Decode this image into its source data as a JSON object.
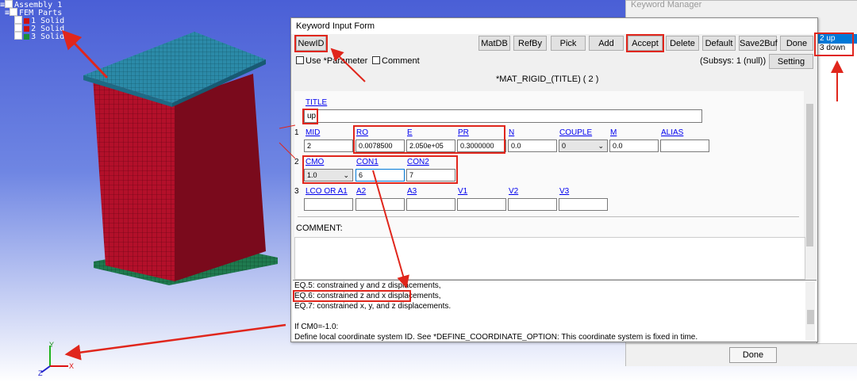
{
  "tree": {
    "assembly": "Assembly 1",
    "parts_group": "FEM Parts",
    "parts": [
      {
        "label": "1 Solid",
        "color": "#cc1111"
      },
      {
        "label": "2 Solid",
        "color": "#cc1111"
      },
      {
        "label": "3 Solid",
        "color": "#1a8f3a"
      }
    ]
  },
  "axis": {
    "x": "X",
    "y": "Y",
    "z": "Z"
  },
  "keyword_manager": {
    "title": "Keyword Manager",
    "items": [
      {
        "label": "2  up",
        "selected": true
      },
      {
        "label": "3  down",
        "selected": false
      }
    ],
    "done_label": "Done"
  },
  "form": {
    "title": "Keyword Input Form",
    "buttons": {
      "newid": "NewID",
      "matdb": "MatDB",
      "refby": "RefBy",
      "pick": "Pick",
      "add": "Add",
      "accept": "Accept",
      "delete": "Delete",
      "default": "Default",
      "save2buf": "Save2Buf",
      "done": "Done"
    },
    "use_parameter": "Use *Parameter",
    "comment_check": "Comment",
    "subsys": "(Subsys: 1 (null))",
    "setting": "Setting",
    "keyword": "*MAT_RIGID_(TITLE)  ( 2 )",
    "title_label": "TITLE",
    "title_value": "up",
    "row1_num": "1",
    "row1": [
      {
        "label": "MID",
        "value": "2"
      },
      {
        "label": "RO",
        "value": "0.0078500"
      },
      {
        "label": "E",
        "value": "2.050e+05"
      },
      {
        "label": "PR",
        "value": "0.3000000"
      },
      {
        "label": "N",
        "value": "0.0"
      },
      {
        "label": "COUPLE",
        "value": "0"
      },
      {
        "label": "M",
        "value": "0.0"
      },
      {
        "label": "ALIAS",
        "value": ""
      }
    ],
    "row2_num": "2",
    "row2": [
      {
        "label": "CMO",
        "value": "1.0"
      },
      {
        "label": "CON1",
        "value": "6"
      },
      {
        "label": "CON2",
        "value": "7"
      }
    ],
    "row3_num": "3",
    "row3": [
      {
        "label": "LCO OR A1",
        "value": ""
      },
      {
        "label": "A2",
        "value": ""
      },
      {
        "label": "A3",
        "value": ""
      },
      {
        "label": "V1",
        "value": ""
      },
      {
        "label": "V2",
        "value": ""
      },
      {
        "label": "V3",
        "value": ""
      }
    ],
    "comment_label": "COMMENT:",
    "help_lines": [
      "EQ.5: constrained y and z displacements,",
      "EQ.6: constrained z and x displacements,",
      "EQ.7: constrained x, y, and z displacements.",
      "",
      "If CM0=-1.0:",
      "Define local coordinate system ID. See *DEFINE_COORDINATE_OPTION: This coordinate system is fixed in time."
    ]
  },
  "colors": {
    "accent": "#e0261c",
    "mesh_red": "#b3102a",
    "mesh_blue": "#2b8aa8",
    "mesh_green": "#1f7a4f"
  }
}
